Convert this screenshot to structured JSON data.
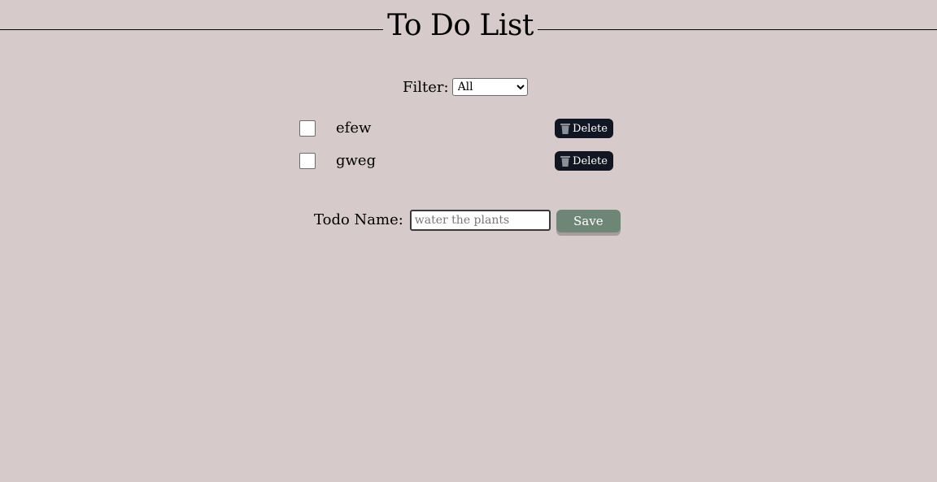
{
  "header": {
    "title": "To Do List"
  },
  "filter": {
    "label": "Filter:",
    "selected": "All",
    "options": [
      "All"
    ]
  },
  "todos": [
    {
      "label": "efew",
      "checked": false,
      "delete_label": "Delete"
    },
    {
      "label": "gweg",
      "checked": false,
      "delete_label": "Delete"
    }
  ],
  "form": {
    "label": "Todo Name:",
    "input_placeholder": "water the plants",
    "input_value": "",
    "save_label": "Save"
  },
  "colors": {
    "background": "#d7cacb",
    "delete_button": "#101722",
    "save_button": "#6e8676"
  },
  "icons": {
    "delete": "trash-icon"
  }
}
